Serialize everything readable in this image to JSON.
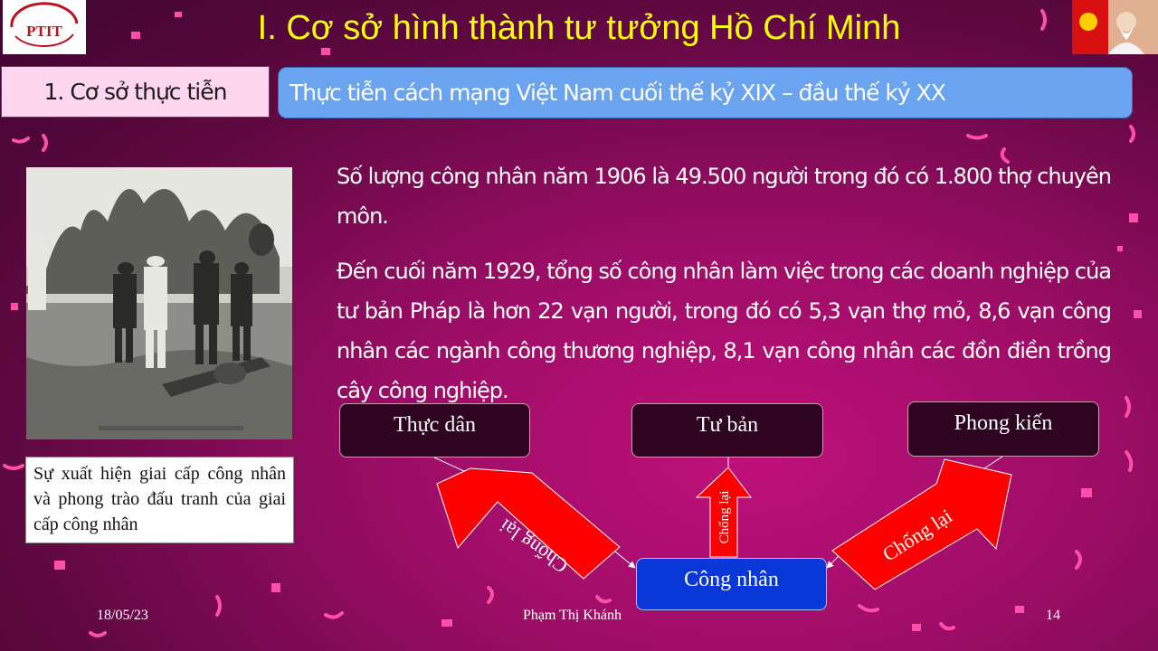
{
  "slide": {
    "title": "I. Cơ sở hình thành tư tưởng Hồ Chí Minh",
    "section_label": "1. Cơ sở thực tiễn",
    "subtitle": "Thực tiễn cách mạng Việt Nam cuối thế kỷ XIX – đầu thế kỷ XX",
    "paragraphs": [
      "Số lượng công nhân năm 1906 là 49.500 người trong đó có 1.800 thợ chuyên môn.",
      "Đến cuối năm 1929, tổng số công nhân làm việc trong các doanh nghiệp của tư bản Pháp là hơn 22 vạn người, trong đó có 5,3 vạn thợ mỏ, 8,6 vạn công nhân các ngành công thương nghiệp, 8,1 vạn công nhân các đồn điền trồng cây công nghiệp."
    ],
    "image_caption": "Sự xuất hiện giai cấp công nhân và phong trào đấu tranh của giai cấp công nhân",
    "logo_left_text": "PTIT"
  },
  "diagram": {
    "nodes": {
      "colonists": "Thực dân",
      "capitalists": "Tư bản",
      "feudalism": "Phong kiến",
      "workers": "Công nhân"
    },
    "arrow_label": "Chống lại"
  },
  "footer": {
    "date": "18/05/23",
    "author": "Phạm Thị Khánh",
    "page": "14"
  },
  "colors": {
    "title": "#ffff00",
    "subtitle_bg": "#6aa3f0",
    "arrow_fill": "#ff0000",
    "worker_box": "#0a38d8",
    "node_box": "#2e0420"
  }
}
